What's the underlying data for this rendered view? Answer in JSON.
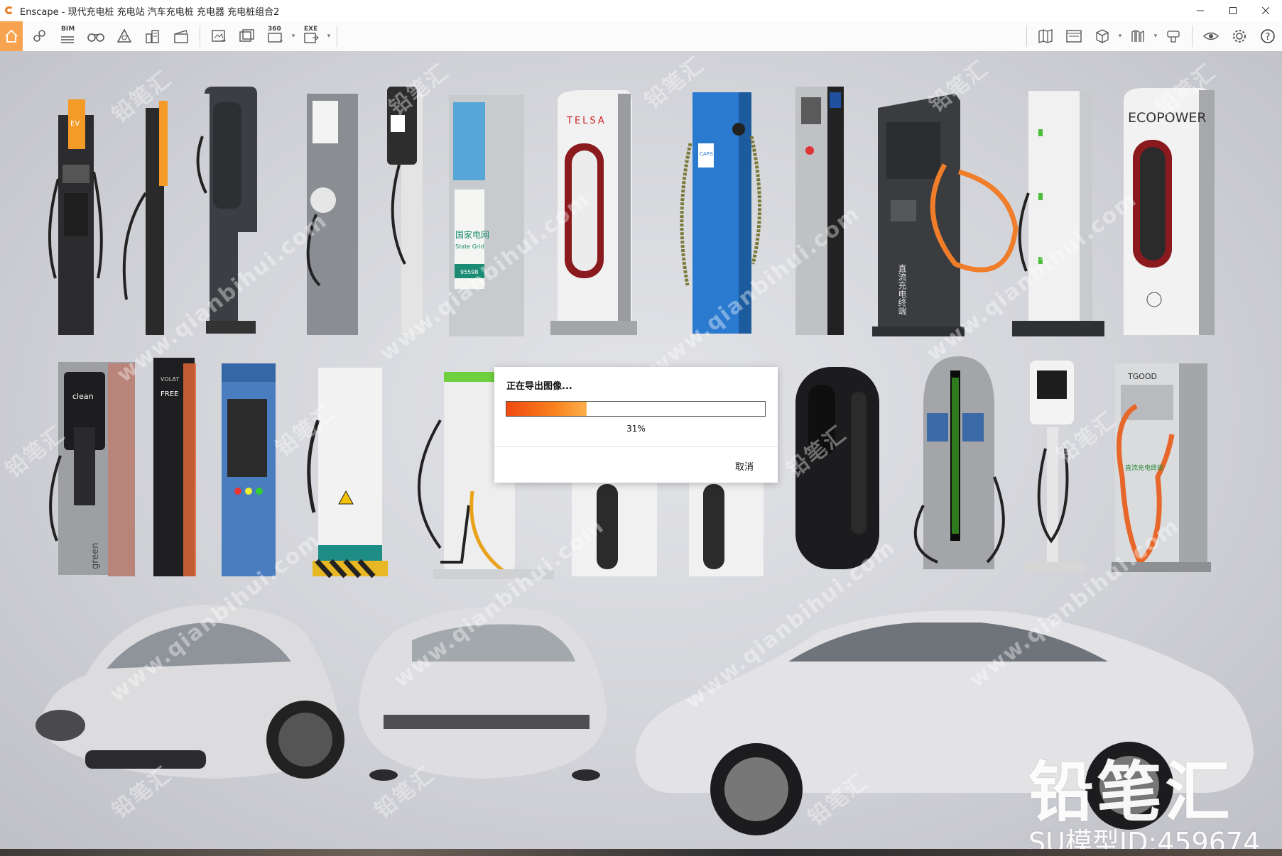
{
  "window": {
    "app_name": "Enscape",
    "title": "Enscape - 现代充电桩 充电站 汽车充电桩 充电器 充电桩组合2",
    "controls": [
      "minimize",
      "maximize",
      "close"
    ]
  },
  "toolbar": {
    "left_buttons": [
      {
        "name": "home-icon",
        "active": true
      },
      {
        "name": "location-pin-icon"
      },
      {
        "name": "bim-icon",
        "label": "BIM"
      },
      {
        "name": "binoculars-icon"
      },
      {
        "name": "asset-library-icon"
      },
      {
        "name": "buildings-icon"
      },
      {
        "name": "clapperboard-icon"
      },
      {
        "name": "screenshot-icon"
      },
      {
        "name": "batch-render-icon"
      },
      {
        "name": "panorama-icon",
        "label": "360"
      },
      {
        "name": "export-exe-icon",
        "label": "EXE"
      }
    ],
    "right_buttons": [
      {
        "name": "map-icon"
      },
      {
        "name": "panel-icon"
      },
      {
        "name": "box-icon"
      },
      {
        "name": "library-icon"
      },
      {
        "name": "material-icon"
      },
      {
        "name": "eye-icon"
      },
      {
        "name": "settings-icon"
      },
      {
        "name": "help-icon"
      }
    ]
  },
  "viewport": {
    "watermark_text": "www.qianbihui.com",
    "watermark_logo": "铅笔汇",
    "brand": {
      "name": "铅笔汇",
      "model_id": "SU模型ID:459674"
    },
    "charger_labels": {
      "ev": "EV",
      "tesla": "TELSA",
      "cars_go": "CARS GO",
      "ecopower": "ECOPOWER",
      "state_grid": "国家电网",
      "state_grid_en": "State Grid",
      "state_grid_num": "95598",
      "dc_terminal": "直流充电终端",
      "free": "FREE",
      "volat": "VOLAT",
      "tgood": "TGOOD",
      "tgood_label": "直流充电终端",
      "clean": "clean",
      "green": "green"
    }
  },
  "export_dialog": {
    "title": "正在导出图像...",
    "progress_percent": 31,
    "progress_label": "31%",
    "cancel_label": "取消"
  },
  "colors": {
    "accent_orange": "#f7a34f",
    "progress_start": "#f04a10",
    "progress_end": "#fdb04c"
  }
}
